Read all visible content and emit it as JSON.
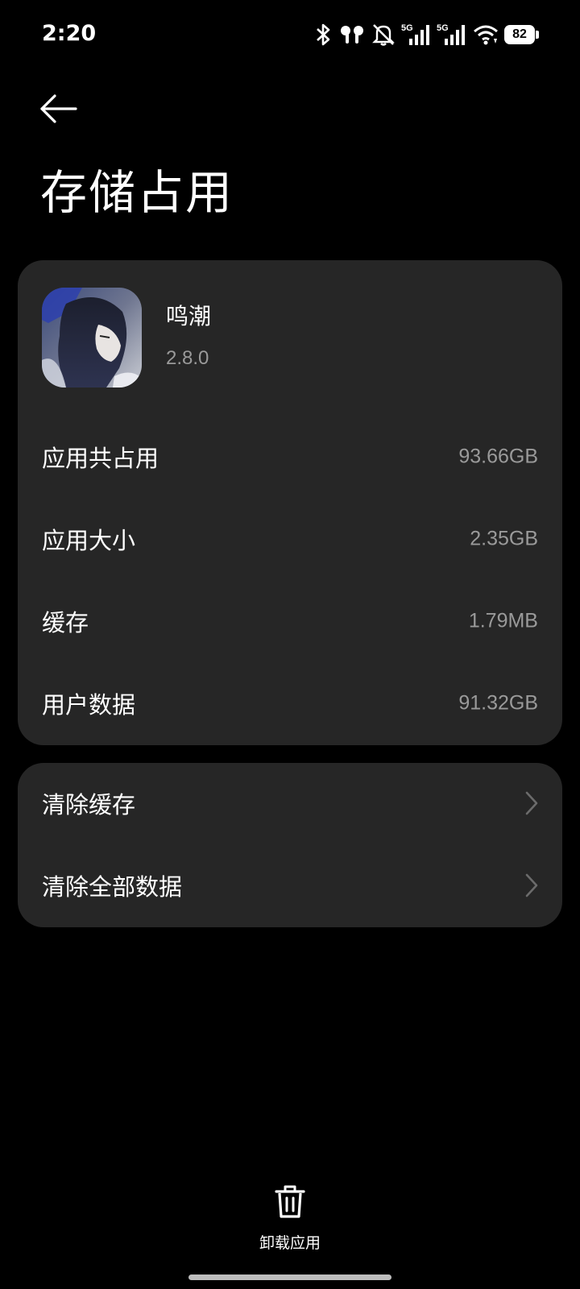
{
  "status": {
    "time": "2:20",
    "battery": "82",
    "network_badge": "5G"
  },
  "header": {
    "title": "存储占用"
  },
  "app": {
    "name": "鸣潮",
    "version": "2.8.0"
  },
  "storage": {
    "rows": [
      {
        "label": "应用共占用",
        "value": "93.66GB"
      },
      {
        "label": "应用大小",
        "value": "2.35GB"
      },
      {
        "label": "缓存",
        "value": "1.79MB"
      },
      {
        "label": "用户数据",
        "value": "91.32GB"
      }
    ]
  },
  "actions": {
    "items": [
      {
        "label": "清除缓存"
      },
      {
        "label": "清除全部数据"
      }
    ]
  },
  "bottom": {
    "uninstall_label": "卸载应用"
  },
  "colors": {
    "background": "#000000",
    "card": "#262626",
    "secondary_text": "#9a9a9a"
  }
}
